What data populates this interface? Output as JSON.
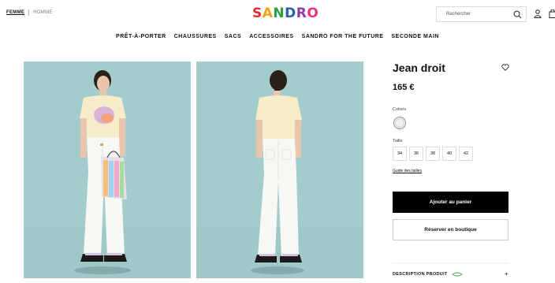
{
  "header": {
    "gender_active": "FEMME",
    "gender_other": "HOMME",
    "logo_letters": [
      {
        "char": "S",
        "color": "#e8262d"
      },
      {
        "char": "A",
        "color": "#f3a21a"
      },
      {
        "char": "N",
        "color": "#27a344"
      },
      {
        "char": "D",
        "color": "#2860b0"
      },
      {
        "char": "R",
        "color": "#8a3da6"
      },
      {
        "char": "O",
        "color": "#e3318c"
      }
    ],
    "search_placeholder": "Rechercher",
    "icons": [
      "search-icon",
      "user-icon",
      "bag-icon"
    ]
  },
  "nav": {
    "items": [
      "PRÊT-À-PORTER",
      "CHAUSSURES",
      "SACS",
      "ACCESSOIRES",
      "SANDRO FOR THE FUTURE",
      "SECONDE MAIN"
    ]
  },
  "product": {
    "title": "Jean droit",
    "price": "165 €",
    "color_label": "Coloris",
    "color_value": "#f1efe9",
    "size_label": "Taille",
    "sizes": [
      "34",
      "36",
      "38",
      "40",
      "42"
    ],
    "size_guide": "Guide des tailles",
    "add_to_cart": "Ajouter au panier",
    "reserve": "Réserver en boutique",
    "description_label": "DESCRIPTION PRODUIT",
    "description_toggle": "+"
  },
  "colors": {
    "photo_bg": "#9ec9c8",
    "accent_black": "#000000",
    "eco_green": "#4caf50"
  }
}
